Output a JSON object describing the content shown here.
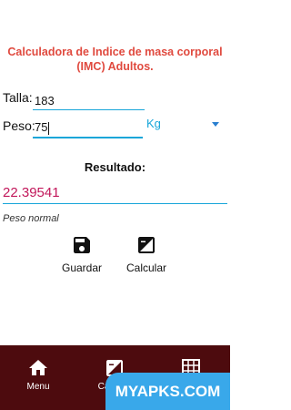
{
  "title": "Calculadora de Indice de masa corporal (IMC) Adultos.",
  "form": {
    "talla_label": "Talla:",
    "talla_value": "183",
    "peso_label": "Peso:",
    "peso_value": "75",
    "unit": "Kg"
  },
  "result": {
    "label": "Resultado:",
    "value": "22.39541",
    "category": "Peso normal"
  },
  "actions": {
    "save_label": "Guardar",
    "calc_label": "Calcular"
  },
  "nav": {
    "menu_label": "Menu",
    "calc_label": "Calcular"
  },
  "watermark": "MYAPKS.COM",
  "colors": {
    "title": "#e04a3f",
    "accent": "#18a6d9",
    "result": "#c2185b",
    "navbar": "#4d0b0e",
    "watermark": "#39a8ea"
  },
  "icons": [
    "save-icon",
    "calculate-icon",
    "home-icon",
    "table-icon",
    "dropdown-arrow-icon"
  ]
}
